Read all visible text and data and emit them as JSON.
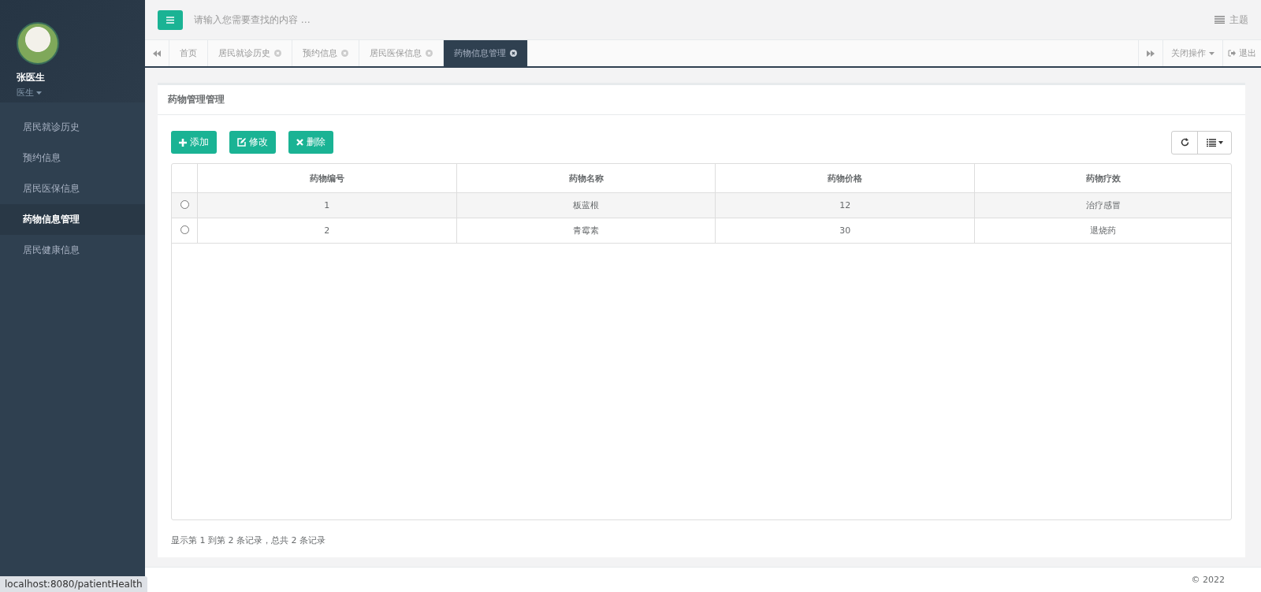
{
  "sidebar": {
    "user": {
      "name": "张医生",
      "role": "医生"
    },
    "items": [
      {
        "label": "居民就诊历史",
        "selected": false
      },
      {
        "label": "预约信息",
        "selected": false
      },
      {
        "label": "居民医保信息",
        "selected": false
      },
      {
        "label": "药物信息管理",
        "selected": true
      },
      {
        "label": "居民健康信息",
        "selected": false
      }
    ]
  },
  "topbar": {
    "search": {
      "placeholder": "请输入您需要查找的内容 …"
    },
    "theme": "主题"
  },
  "tabs": [
    {
      "label": "首页",
      "selected": false,
      "closable": false
    },
    {
      "label": "居民就诊历史",
      "selected": false,
      "closable": true
    },
    {
      "label": "预约信息",
      "selected": false,
      "closable": true
    },
    {
      "label": "居民医保信息",
      "selected": false,
      "closable": true
    },
    {
      "label": "药物信息管理",
      "selected": true,
      "closable": true
    }
  ],
  "tab_actions": {
    "close_ops": "关闭操作",
    "logout": "退出"
  },
  "panel": {
    "title": "药物管理管理",
    "buttons": [
      {
        "kind": "add",
        "label": "添加"
      },
      {
        "kind": "edit",
        "label": "修改"
      },
      {
        "kind": "delete",
        "label": "删除"
      }
    ],
    "table": {
      "columns": [
        "药物编号",
        "药物名称",
        "药物价格",
        "药物疗效"
      ],
      "rows": [
        {
          "selected": false,
          "cells": [
            "1",
            "板蓝根",
            "12",
            "治疗感冒"
          ]
        },
        {
          "selected": false,
          "cells": [
            "2",
            "青霉素",
            "30",
            "退烧药"
          ]
        }
      ]
    },
    "pagination": "显示第 1 到第 2 条记录，总共 2 条记录"
  },
  "footer": {
    "copyright": "© 2022"
  },
  "status_bar": {
    "url": "localhost:8080/patientHealth"
  }
}
